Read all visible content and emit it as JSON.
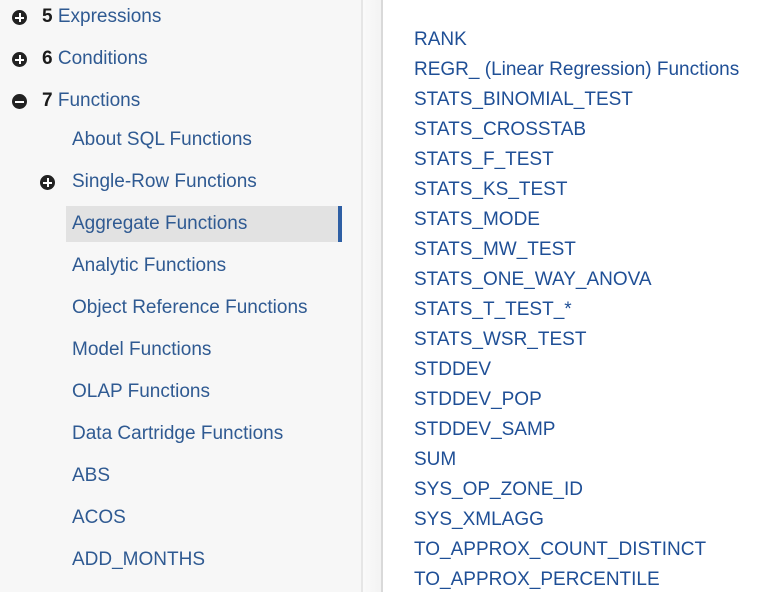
{
  "sidebar": {
    "sections": [
      {
        "number": "5",
        "label": "Expressions",
        "state": "collapsed"
      },
      {
        "number": "6",
        "label": "Conditions",
        "state": "collapsed"
      },
      {
        "number": "7",
        "label": "Functions",
        "state": "expanded"
      }
    ],
    "function_items": [
      {
        "label": "About SQL Functions"
      },
      {
        "label": "Single-Row Functions",
        "expandable": true
      },
      {
        "label": "Aggregate Functions",
        "selected": true
      },
      {
        "label": "Analytic Functions"
      },
      {
        "label": "Object Reference Functions"
      },
      {
        "label": "Model Functions"
      },
      {
        "label": "OLAP Functions"
      },
      {
        "label": "Data Cartridge Functions"
      },
      {
        "label": "ABS"
      },
      {
        "label": "ACOS"
      },
      {
        "label": "ADD_MONTHS"
      }
    ]
  },
  "content": {
    "links": [
      "RANK",
      "REGR_ (Linear Regression) Functions",
      "STATS_BINOMIAL_TEST",
      "STATS_CROSSTAB",
      "STATS_F_TEST",
      "STATS_KS_TEST",
      "STATS_MODE",
      "STATS_MW_TEST",
      "STATS_ONE_WAY_ANOVA",
      "STATS_T_TEST_*",
      "STATS_WSR_TEST",
      "STDDEV",
      "STDDEV_POP",
      "STDDEV_SAMP",
      "SUM",
      "SYS_OP_ZONE_ID",
      "SYS_XMLAGG",
      "TO_APPROX_COUNT_DISTINCT",
      "TO_APPROX_PERCENTILE"
    ]
  },
  "colors": {
    "link": "#1f4f96",
    "nav_link": "#2f5a92",
    "selected_bg": "#e2e2e2",
    "selected_bar": "#2e5fa4"
  }
}
